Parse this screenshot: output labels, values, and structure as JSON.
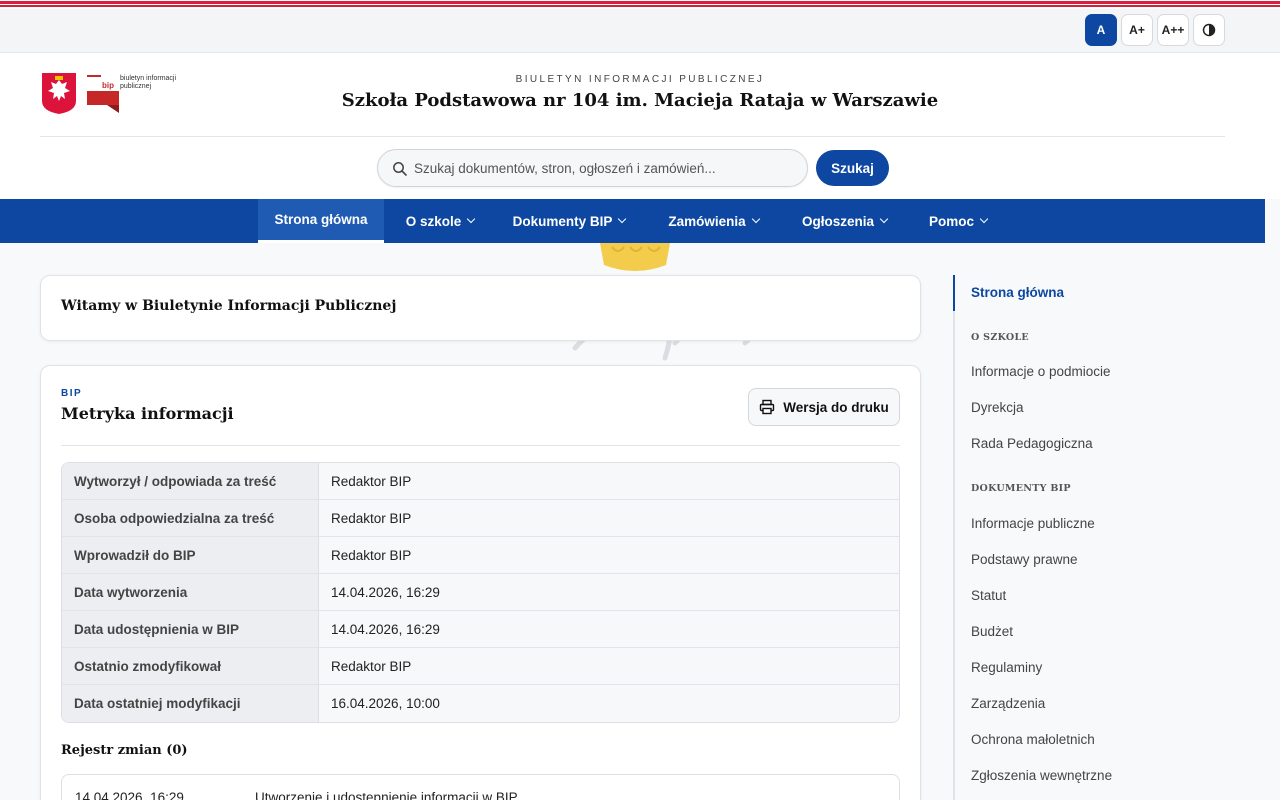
{
  "accessibility": {
    "font_normal": "A",
    "font_larger": "A+",
    "font_largest": "A++"
  },
  "header": {
    "bip_logo_text": "biuletyn informacji publicznej",
    "bip_badge": "bip",
    "subtitle": "BIULETYN INFORMACJI PUBLICZNEJ",
    "title": "Szkoła Podstawowa nr 104 im. Macieja Rataja w Warszawie"
  },
  "search": {
    "placeholder": "Szukaj dokumentów, stron, ogłoszeń i zamówień...",
    "button": "Szukaj"
  },
  "nav": {
    "items": [
      {
        "label": "Strona główna"
      },
      {
        "label": "O szkole"
      },
      {
        "label": "Dokumenty BIP"
      },
      {
        "label": "Zamówienia"
      },
      {
        "label": "Ogłoszenia"
      },
      {
        "label": "Pomoc"
      }
    ]
  },
  "welcome": {
    "title": "Witamy w Biuletynie Informacji Publicznej"
  },
  "metryka": {
    "kicker": "BIP",
    "title": "Metryka informacji",
    "print_label": "Wersja do druku",
    "rows": [
      {
        "key": "Wytworzył / odpowiada za treść",
        "value": "Redaktor BIP"
      },
      {
        "key": "Osoba odpowiedzialna za treść",
        "value": "Redaktor BIP"
      },
      {
        "key": "Wprowadził do BIP",
        "value": "Redaktor BIP"
      },
      {
        "key": "Data wytworzenia",
        "value": "14.04.2026, 16:29"
      },
      {
        "key": "Data udostępnienia w BIP",
        "value": "14.04.2026, 16:29"
      },
      {
        "key": "Ostatnio zmodyfikował",
        "value": "Redaktor BIP"
      },
      {
        "key": "Data ostatniej modyfikacji",
        "value": "16.04.2026, 10:00"
      }
    ],
    "register_title": "Rejestr zmian (0)",
    "register_rows": [
      {
        "date": "14.04.2026, 16:29",
        "description": "Utworzenie i udostępnienie informacji w BIP"
      }
    ]
  },
  "sidebar": {
    "home": "Strona główna",
    "section1": "O SZKOLE",
    "section1_items": [
      "Informacje o podmiocie",
      "Dyrekcja",
      "Rada Pedagogiczna"
    ],
    "section2": "DOKUMENTY BIP",
    "section2_items": [
      "Informacje publiczne",
      "Podstawy prawne",
      "Statut",
      "Budżet",
      "Regulaminy",
      "Zarządzenia",
      "Ochrona małoletnich",
      "Zgłoszenia wewnętrzne"
    ]
  },
  "colors": {
    "primary": "#0d47a1",
    "accent_red": "#d4213d",
    "emblem_red": "#dc143c"
  }
}
